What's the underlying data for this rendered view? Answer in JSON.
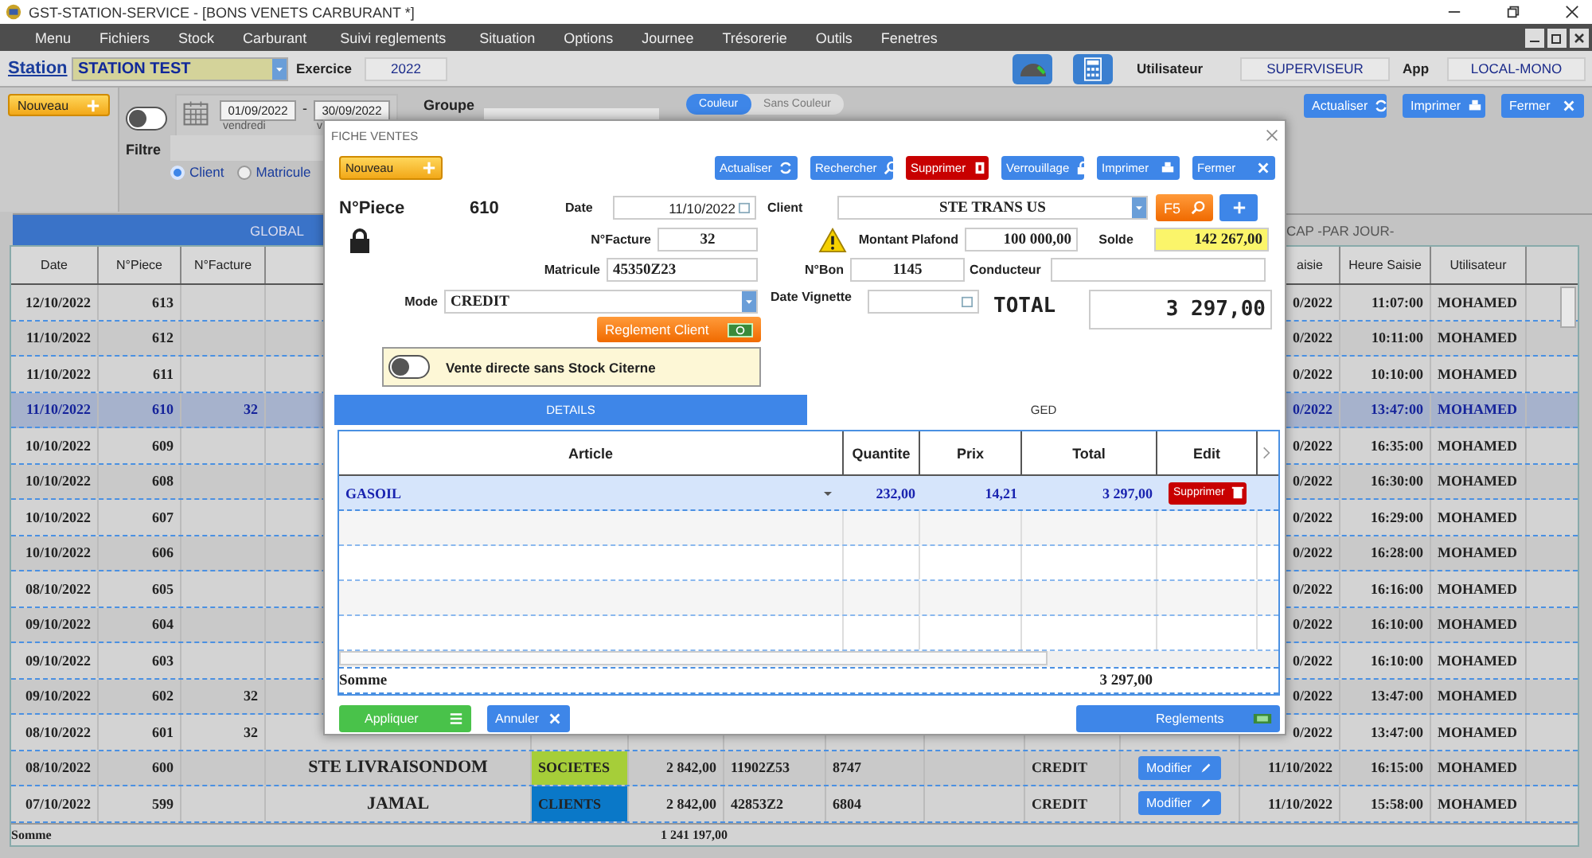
{
  "window": {
    "title": "GST-STATION-SERVICE - [BONS  VENETS  CARBURANT *]"
  },
  "menu": [
    "Menu",
    "Fichiers",
    "Stock",
    "Carburant",
    "Suivi reglements",
    "Situation",
    "Options",
    "Journee",
    "Trésorerie",
    "Outils",
    "Fenetres"
  ],
  "toolbar": {
    "station_label": "Station",
    "station": "STATION TEST",
    "exercice_label": "Exercice",
    "exercice": "2022",
    "user_label": "Utilisateur",
    "user": "SUPERVISEUR",
    "app_label": "App",
    "app": "LOCAL-MONO"
  },
  "panel": {
    "new_button": "Nouveau",
    "toggle_on": false,
    "date_from": "01/09/2022",
    "day_from": "vendredi",
    "date_separator": "-",
    "date_to": "30/09/2022",
    "day_to": "v",
    "groupe_label": "Groupe",
    "color_options": [
      {
        "label": "Couleur",
        "selected": true
      },
      {
        "label": "Sans Couleur",
        "selected": false
      }
    ],
    "buttons": [
      "Actualiser",
      "Imprimer",
      "Fermer"
    ],
    "filter_label": "Filtre",
    "filter_options": [
      {
        "label": "Client",
        "selected": true
      },
      {
        "label": "Matricule",
        "selected": false
      }
    ]
  },
  "tabs": [
    {
      "label": "GLOBAL",
      "selected": true
    },
    {
      "label": "CAP -PAR JOUR-",
      "selected": false
    }
  ],
  "table": {
    "columns": [
      "Date",
      "N°Piece",
      "N°Facture",
      "aisie",
      "Heure Saisie",
      "Utilisateur"
    ],
    "rows": [
      {
        "date": "12/10/2022",
        "piece": "613",
        "date_saisie": "0/2022",
        "heure": "11:07:00",
        "user": "MOHAMED",
        "selected": false
      },
      {
        "date": "11/10/2022",
        "piece": "612",
        "date_saisie": "0/2022",
        "heure": "10:11:00",
        "user": "MOHAMED",
        "selected": false
      },
      {
        "date": "11/10/2022",
        "piece": "611",
        "date_saisie": "0/2022",
        "heure": "10:10:00",
        "user": "MOHAMED",
        "selected": false
      },
      {
        "date": "11/10/2022",
        "piece": "610",
        "facture": "32",
        "date_saisie": "0/2022",
        "heure": "13:47:00",
        "user": "MOHAMED",
        "selected": true
      },
      {
        "date": "10/10/2022",
        "piece": "609",
        "date_saisie": "0/2022",
        "heure": "16:35:00",
        "user": "MOHAMED",
        "selected": false
      },
      {
        "date": "10/10/2022",
        "piece": "608",
        "date_saisie": "0/2022",
        "heure": "16:30:00",
        "user": "MOHAMED",
        "selected": false
      },
      {
        "date": "10/10/2022",
        "piece": "607",
        "date_saisie": "0/2022",
        "heure": "16:29:00",
        "user": "MOHAMED",
        "selected": false
      },
      {
        "date": "10/10/2022",
        "piece": "606",
        "date_saisie": "0/2022",
        "heure": "16:28:00",
        "user": "MOHAMED",
        "selected": false
      },
      {
        "date": "08/10/2022",
        "piece": "605",
        "date_saisie": "0/2022",
        "heure": "16:16:00",
        "user": "MOHAMED",
        "selected": false
      },
      {
        "date": "09/10/2022",
        "piece": "604",
        "date_saisie": "0/2022",
        "heure": "16:10:00",
        "user": "MOHAMED",
        "selected": false
      },
      {
        "date": "09/10/2022",
        "piece": "603",
        "date_saisie": "0/2022",
        "heure": "16:10:00",
        "user": "MOHAMED",
        "selected": false
      },
      {
        "date": "09/10/2022",
        "piece": "602",
        "facture": "32",
        "date_saisie": "0/2022",
        "heure": "13:47:00",
        "user": "MOHAMED",
        "selected": false
      },
      {
        "date": "08/10/2022",
        "piece": "601",
        "facture": "32",
        "date_saisie": "0/2022",
        "heure": "13:47:00",
        "user": "MOHAMED",
        "selected": false
      },
      {
        "date": "08/10/2022",
        "piece": "600",
        "client": "STE LIVRAISONDOM",
        "groupe": "SOCIETES",
        "color": "#a6ce39",
        "montant": "2 842,00",
        "matricule": "11902Z53",
        "bon": "8747",
        "mode": "CREDIT",
        "action": "Modifier",
        "date_saisie": "11/10/2022",
        "heure": "16:15:00",
        "user": "MOHAMED",
        "selected": false
      },
      {
        "date": "07/10/2022",
        "piece": "599",
        "client": "JAMAL",
        "groupe": "CLIENTS",
        "color": "#0a78c8",
        "montant": "2 842,00",
        "matricule": "42853Z2",
        "bon": "6804",
        "mode": "CREDIT",
        "action": "Modifier",
        "date_saisie": "11/10/2022",
        "heure": "15:58:00",
        "user": "MOHAMED",
        "selected": false
      }
    ],
    "footer_label": "Somme",
    "footer_total": "1 241 197,00"
  },
  "dialog": {
    "title": "FICHE VENTES",
    "buttons": [
      {
        "label": "Nouveau",
        "kind": "new"
      },
      {
        "label": "Actualiser",
        "kind": "refresh"
      },
      {
        "label": "Rechercher",
        "kind": "search"
      },
      {
        "label": "Supprimer",
        "kind": "delete"
      },
      {
        "label": "Verrouillage",
        "kind": "lock"
      },
      {
        "label": "Imprimer",
        "kind": "print"
      },
      {
        "label": "Fermer",
        "kind": "close"
      }
    ],
    "piece_label": "N°Piece",
    "piece": "610",
    "date_label": "Date",
    "date": "11/10/2022",
    "client_label": "Client",
    "client": "STE  TRANS US",
    "f5_button": "F5",
    "facture_label": "N°Facture",
    "facture": "32",
    "plafond_label": "Montant Plafond",
    "plafond": "100 000,00",
    "solde_label": "Solde",
    "solde": "142 267,00",
    "matricule_label": "Matricule",
    "matricule": "45350Z23",
    "bon_label": "N°Bon",
    "bon": "1145",
    "conducteur_label": "Conducteur",
    "mode_label": "Mode",
    "mode": "CREDIT",
    "vignette_label": "Date Vignette",
    "total_label": "TOTAL",
    "total": "3 297,00",
    "reglement_button": "Reglement Client",
    "direct_toggle_on": false,
    "direct_label": "Vente directe sans Stock Citerne",
    "tabs": [
      {
        "label": "DETAILS",
        "selected": true
      },
      {
        "label": "GED",
        "selected": false
      }
    ],
    "grid": {
      "columns": [
        "Article",
        "Quantite",
        "Prix",
        "Total",
        "Edit"
      ],
      "rows": [
        {
          "article": "GASOIL",
          "quantite": "232,00",
          "prix": "14,21",
          "total": "3 297,00",
          "action": "Supprimer",
          "selected": true
        }
      ],
      "sum_label": "Somme",
      "sum_total": "3 297,00"
    },
    "footer_buttons": [
      {
        "label": "Appliquer",
        "kind": "apply"
      },
      {
        "label": "Annuler",
        "kind": "cancel"
      },
      {
        "label": "Reglements",
        "kind": "payments"
      }
    ]
  }
}
